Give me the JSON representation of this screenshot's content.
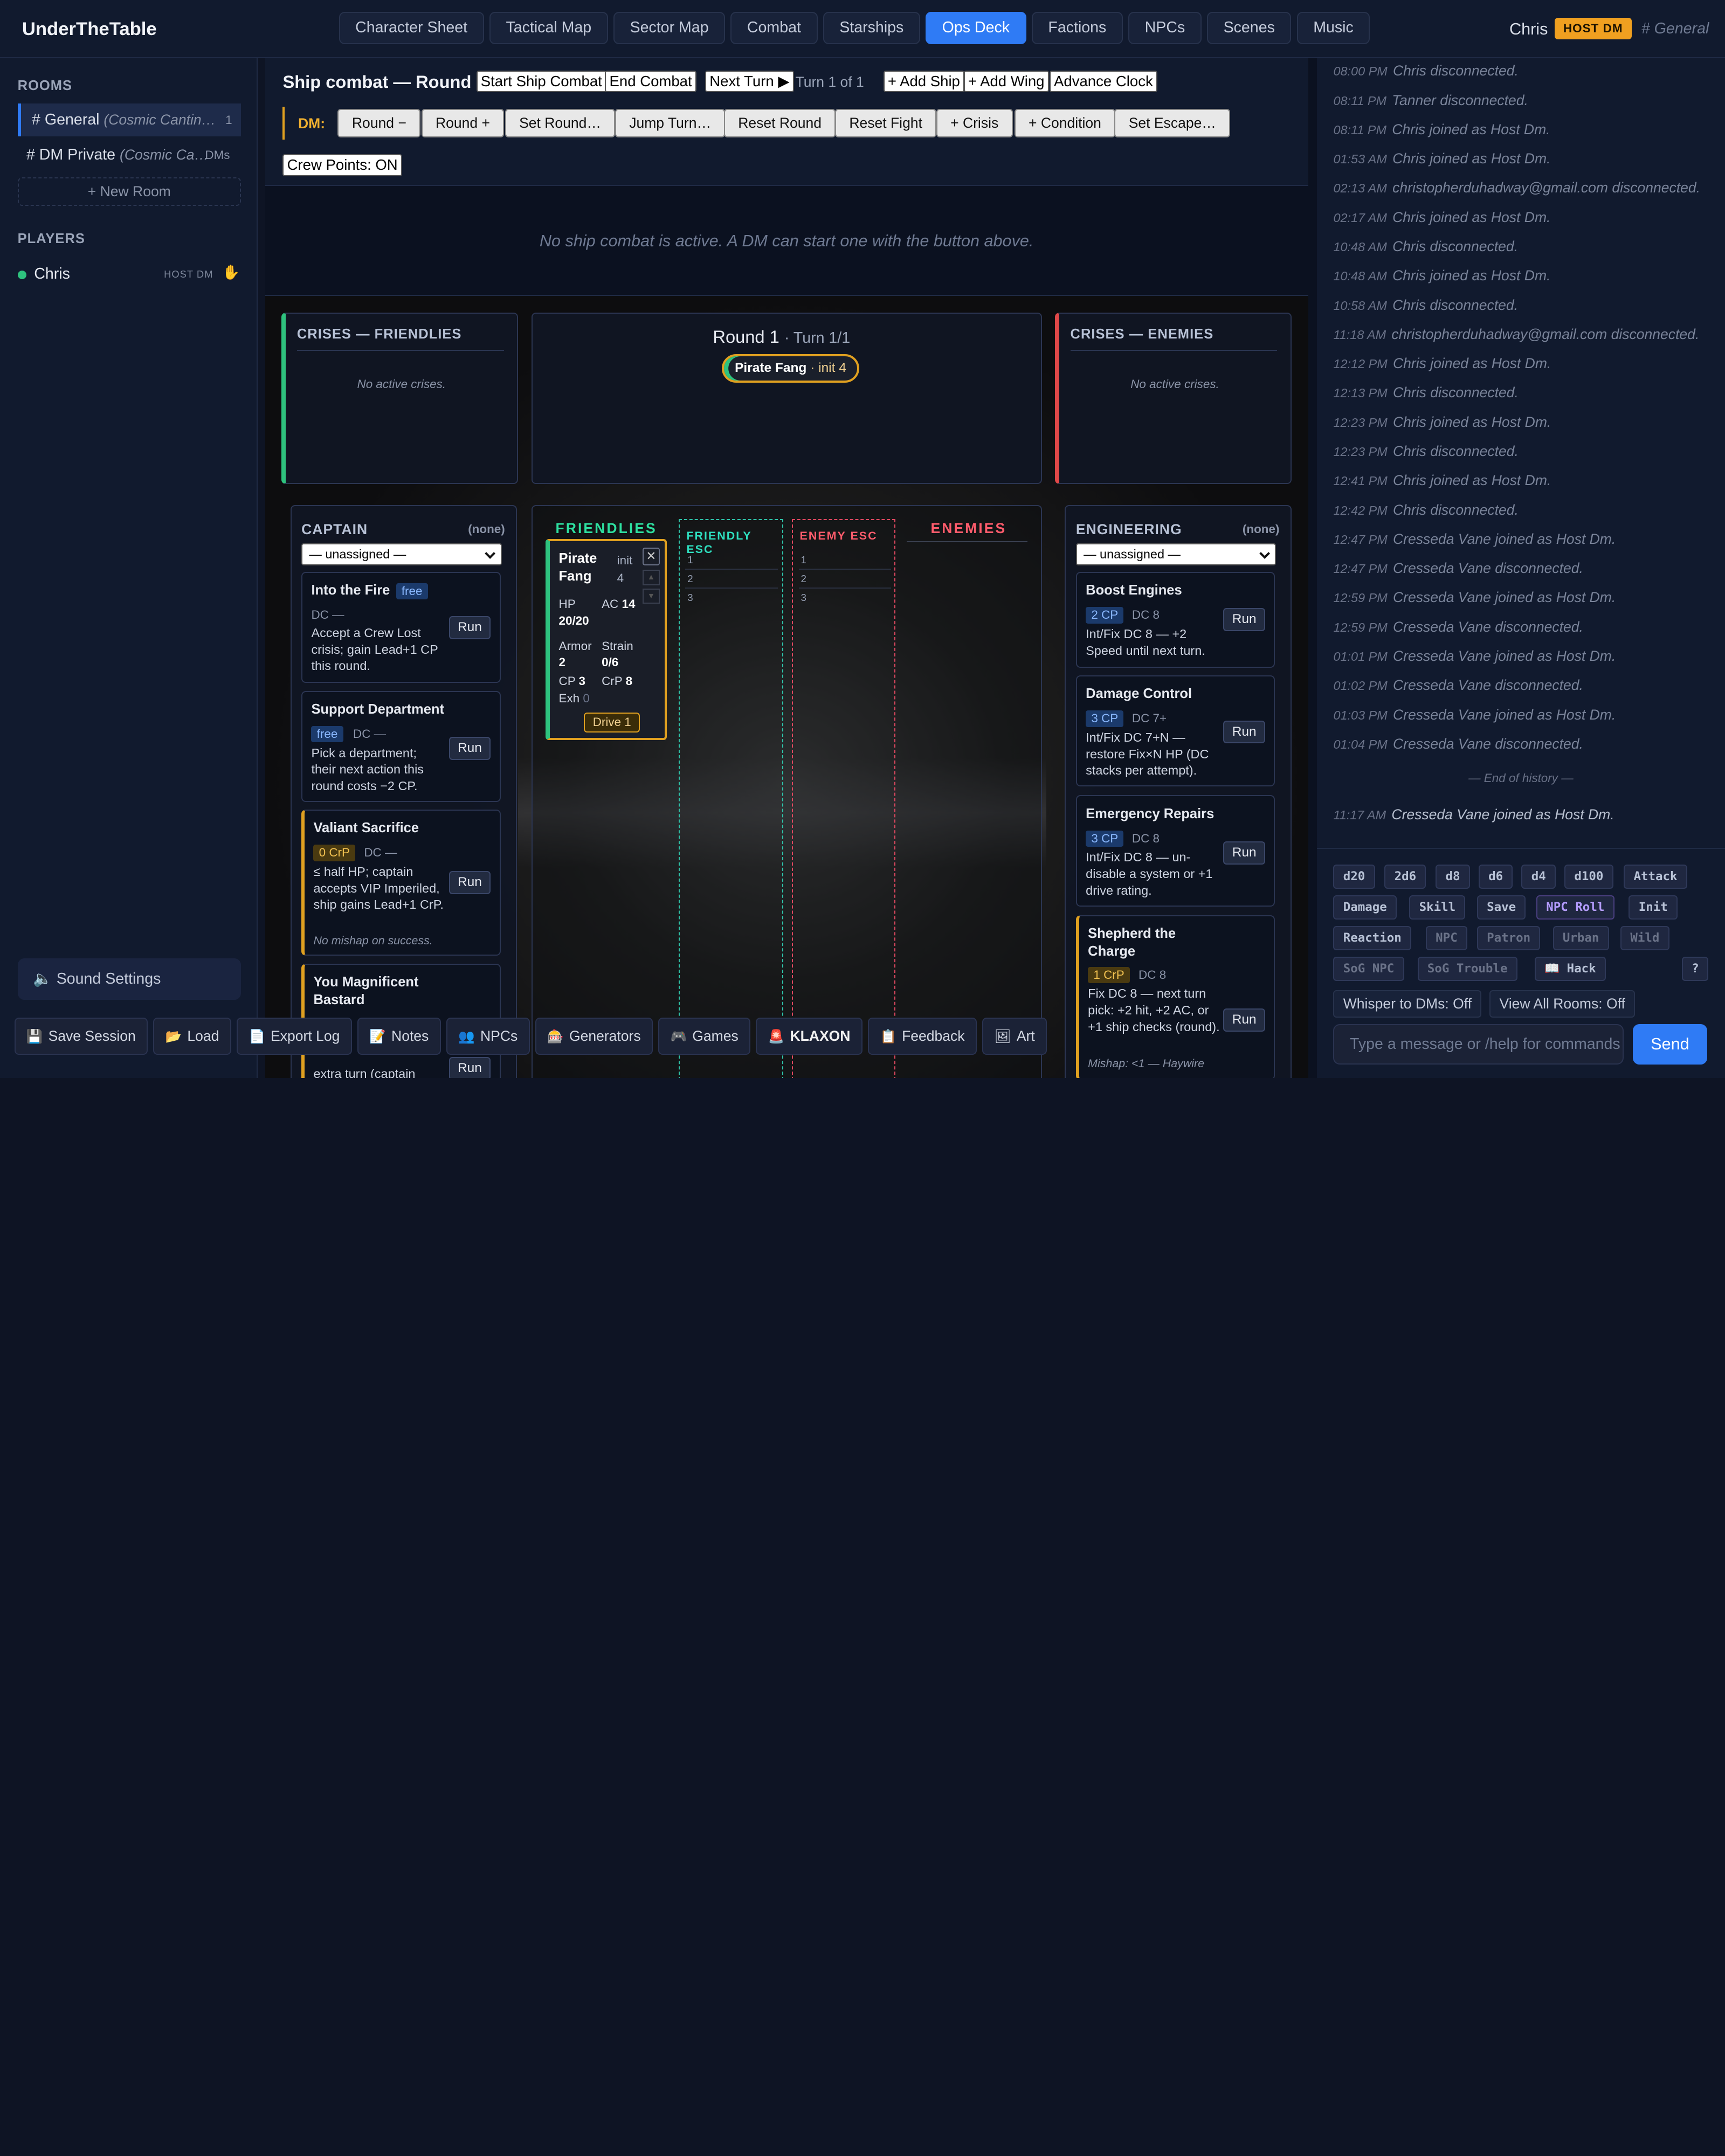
{
  "app": {
    "name": "UnderTheTable"
  },
  "nav": {
    "tabs": [
      "Character Sheet",
      "Tactical Map",
      "Sector Map",
      "Combat",
      "Starships",
      "Ops Deck",
      "Factions",
      "NPCs",
      "Scenes",
      "Music"
    ],
    "active": "Ops Deck"
  },
  "header": {
    "user": "Chris",
    "badge": "HOST DM",
    "room": "# General"
  },
  "sidebar": {
    "rooms_heading": "ROOMS",
    "rooms": [
      {
        "name": "# General",
        "sub": "(Cosmic Cantin…",
        "count": "1"
      },
      {
        "name": "# DM Private",
        "sub": "(Cosmic Ca…",
        "count": "DMs"
      }
    ],
    "new_room": "+ New Room",
    "players_heading": "PLAYERS",
    "players": [
      {
        "name": "Chris",
        "role": "HOST DM"
      }
    ],
    "sound_settings": "Sound Settings"
  },
  "bottombar": [
    {
      "label": "Save Session",
      "icon": "💾"
    },
    {
      "label": "Load",
      "icon": "📂"
    },
    {
      "label": "Export Log",
      "icon": "📄"
    },
    {
      "label": "Notes",
      "icon": "📝"
    },
    {
      "label": "NPCs",
      "icon": "👥"
    },
    {
      "label": "Generators",
      "icon": "🎰"
    },
    {
      "label": "Games",
      "icon": "🎮"
    },
    {
      "label": "KLAXON",
      "icon": "🚨"
    },
    {
      "label": "Feedback",
      "icon": "📋"
    },
    {
      "label": "Art",
      "icon": "🖼"
    }
  ],
  "shipcombat": {
    "title": "Ship combat — Round 1",
    "start": "Start Ship Combat",
    "end": "End Combat",
    "next_turn": "Next Turn ▶",
    "turn_label": "Turn 1 of 1",
    "add_ship": "+ Add Ship",
    "add_wing": "+ Add Wing",
    "advance_clock": "Advance Clock",
    "dm_label": "DM:",
    "dm_buttons": [
      "Round −",
      "Round +",
      "Set Round…",
      "Jump Turn…",
      "Reset Round",
      "Reset Fight",
      "+ Crisis",
      "+ Condition",
      "Set Escape…"
    ],
    "crew_points": "Crew Points: ON",
    "no_active": "No ship combat is active. A DM can start one with the button above."
  },
  "crises": {
    "friendlies_title": "CRISES — FRIENDLIES",
    "enemies_title": "CRISES — ENEMIES",
    "none": "No active crises."
  },
  "round": {
    "label": "Round 1",
    "turn": "· Turn 1/1",
    "pill_name": "Pirate Fang",
    "pill_init": "· init 4"
  },
  "captain": {
    "title": "CAPTAIN",
    "assigned": "(none)",
    "select": "— unassigned —",
    "actions": [
      {
        "name": "Into the Fire",
        "cost": "free",
        "dc": "DC —",
        "desc": "Accept a Crew Lost crisis; gain Lead+1 CP this round.",
        "run": "Run"
      },
      {
        "name": "Support Department",
        "cost": "free",
        "dc": "DC —",
        "desc": "Pick a department; their next action this round costs −2 CP.",
        "run": "Run"
      },
      {
        "name": "Valiant Sacrifice",
        "cost": "0 CrP",
        "dc": "DC —",
        "desc": "≤ half HP; captain accepts VIP Imperiled, ship gains Lead+1 CrP.",
        "note": "No mishap on success.",
        "run": "Run"
      },
      {
        "name": "You Magnificent Bastard",
        "desc": "extra turn (captain",
        "run": "Run"
      }
    ]
  },
  "engineering": {
    "title": "ENGINEERING",
    "assigned": "(none)",
    "select": "— unassigned —",
    "actions": [
      {
        "name": "Boost Engines",
        "cost": "2 CP",
        "dc": "DC 8",
        "desc": "Int/Fix DC 8 — +2 Speed until next turn.",
        "run": "Run"
      },
      {
        "name": "Damage Control",
        "cost": "3 CP",
        "dc": "DC 7+",
        "desc": "Int/Fix DC 7+N — restore Fix×N HP (DC stacks per attempt).",
        "run": "Run"
      },
      {
        "name": "Emergency Repairs",
        "cost": "3 CP",
        "dc": "DC 8",
        "desc": "Int/Fix DC 8 — un-disable a system or +1 drive rating.",
        "run": "Run"
      },
      {
        "name": "Shepherd the Charge",
        "cost": "1 CrP",
        "dc": "DC 8",
        "desc": "Fix DC 8 — next turn pick: +2 hit, +2 AC, or +1 ship checks (round).",
        "note": "Mishap: <1 — Haywire",
        "run": "Run"
      }
    ]
  },
  "board": {
    "friendlies": "FRIENDLIES",
    "enemies": "ENEMIES",
    "friendly_esc": "FRIENDLY ESC",
    "enemy_esc": "ENEMY ESC",
    "esc_rows": [
      "1",
      "2",
      "3"
    ],
    "ship": {
      "name": "Pirate Fang",
      "init": "init 4",
      "close": "✕",
      "up": "▲",
      "down": "▼",
      "hp_label": "HP",
      "hp": "20/20",
      "ac_label": "AC",
      "ac": "14",
      "armor_label": "Armor",
      "armor": "2",
      "strain_label": "Strain",
      "strain": "0/6",
      "cp_label": "CP",
      "cp": "3",
      "crp_label": "CrP",
      "crp": "8",
      "exh_label": "Exh",
      "exh": "0",
      "drive": "Drive 1"
    }
  },
  "chat": {
    "messages": [
      {
        "time": "08:00 PM",
        "text": "Chris disconnected."
      },
      {
        "time": "08:11 PM",
        "text": "Tanner disconnected."
      },
      {
        "time": "08:11 PM",
        "text": "Chris joined as Host Dm."
      },
      {
        "time": "01:53 AM",
        "text": "Chris joined as Host Dm."
      },
      {
        "time": "02:13 AM",
        "text": "christopherduhadway@gmail.com disconnected."
      },
      {
        "time": "02:17 AM",
        "text": "Chris joined as Host Dm."
      },
      {
        "time": "10:48 AM",
        "text": "Chris disconnected."
      },
      {
        "time": "10:48 AM",
        "text": "Chris joined as Host Dm."
      },
      {
        "time": "10:58 AM",
        "text": "Chris disconnected."
      },
      {
        "time": "11:18 AM",
        "text": "christopherduhadway@gmail.com disconnected."
      },
      {
        "time": "12:12 PM",
        "text": "Chris joined as Host Dm."
      },
      {
        "time": "12:13 PM",
        "text": "Chris disconnected."
      },
      {
        "time": "12:23 PM",
        "text": "Chris joined as Host Dm."
      },
      {
        "time": "12:23 PM",
        "text": "Chris disconnected."
      },
      {
        "time": "12:41 PM",
        "text": "Chris joined as Host Dm."
      },
      {
        "time": "12:42 PM",
        "text": "Chris disconnected."
      },
      {
        "time": "12:47 PM",
        "text": "Cresseda Vane joined as Host Dm."
      },
      {
        "time": "12:47 PM",
        "text": "Cresseda Vane disconnected."
      },
      {
        "time": "12:59 PM",
        "text": "Cresseda Vane joined as Host Dm."
      },
      {
        "time": "12:59 PM",
        "text": "Cresseda Vane disconnected."
      },
      {
        "time": "01:01 PM",
        "text": "Cresseda Vane joined as Host Dm."
      },
      {
        "time": "01:02 PM",
        "text": "Cresseda Vane disconnected."
      },
      {
        "time": "01:03 PM",
        "text": "Cresseda Vane joined as Host Dm."
      },
      {
        "time": "01:04 PM",
        "text": "Cresseda Vane disconnected."
      }
    ],
    "end_of_history": "— End of history —",
    "latest": {
      "time": "11:17 AM",
      "text": "Cresseda Vane joined as Host Dm."
    },
    "dice_rows": [
      [
        "d20",
        "2d6",
        "d8",
        "d6",
        "d4",
        "d100",
        "Attack"
      ],
      [
        "Damage",
        "Skill",
        "Save",
        "NPC Roll",
        "Init"
      ],
      [
        "Reaction",
        "NPC",
        "Patron",
        "Urban",
        "Wild"
      ],
      [
        "SoG NPC",
        "SoG Trouble",
        "📖 Hack"
      ]
    ],
    "help": "?",
    "whisper": "Whisper to DMs: Off",
    "view_all": "View All Rooms: Off",
    "placeholder": "Type a message or /help for commands",
    "send": "Send"
  }
}
